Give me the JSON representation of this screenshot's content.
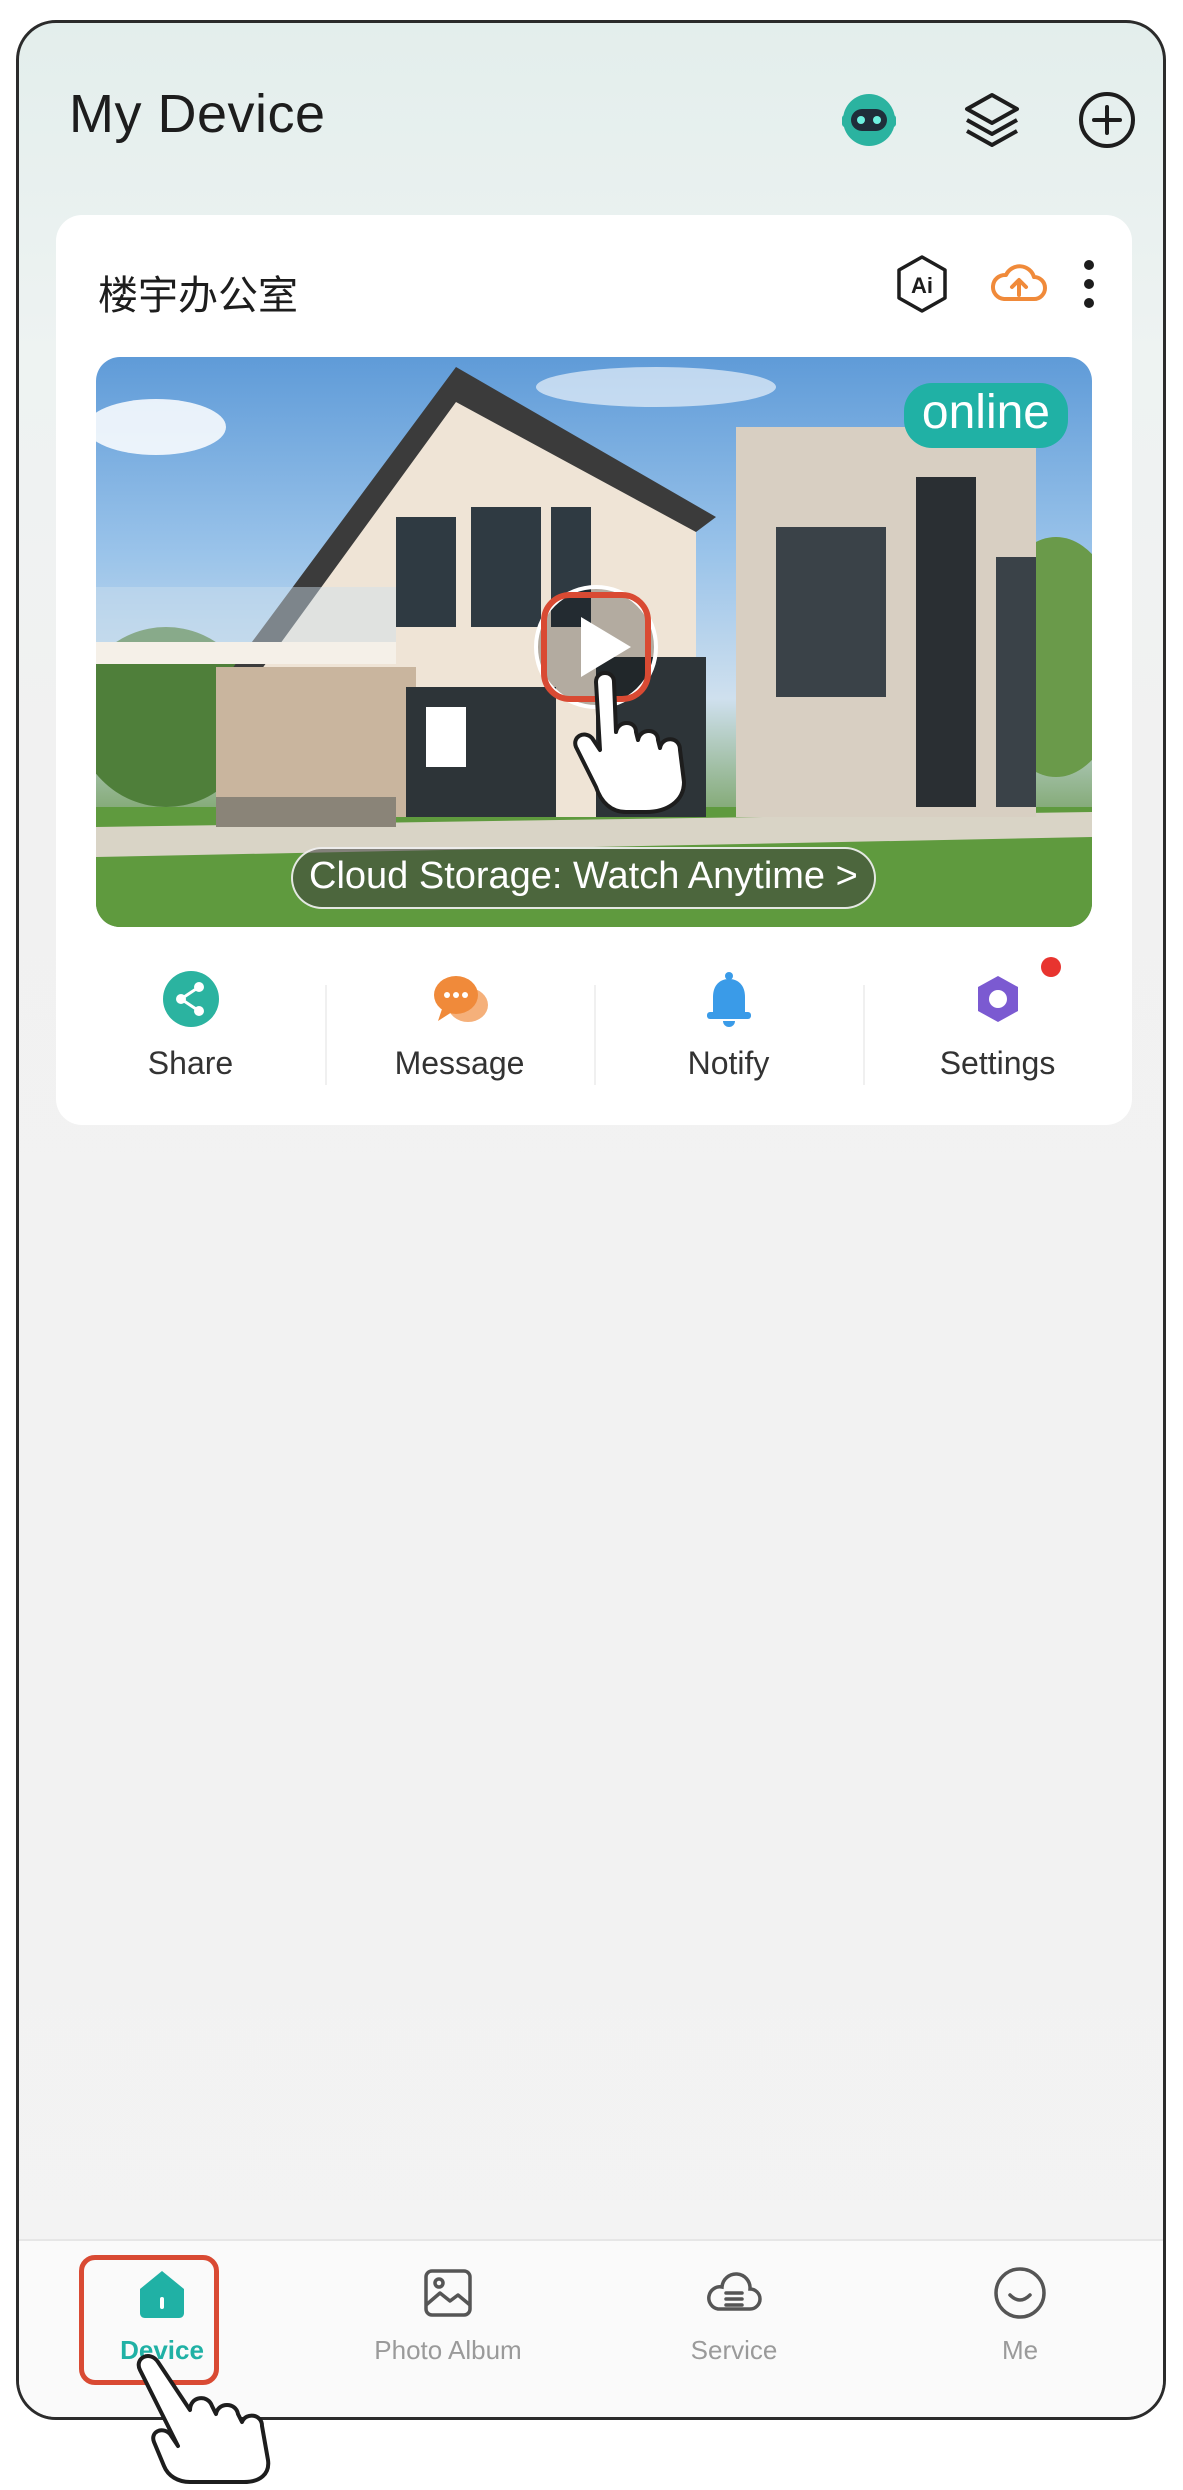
{
  "header": {
    "title": "My Device"
  },
  "device": {
    "name": "楼宇办公室",
    "status": "online",
    "cloud_banner": "Cloud Storage: Watch Anytime >",
    "actions": [
      {
        "label": "Share",
        "icon": "share-icon",
        "color": "#2bb3a0"
      },
      {
        "label": "Message",
        "icon": "message-icon",
        "color": "#f08a3a"
      },
      {
        "label": "Notify",
        "icon": "bell-icon",
        "color": "#3a9be8"
      },
      {
        "label": "Settings",
        "icon": "gear-icon",
        "color": "#7b5ad1"
      }
    ]
  },
  "bottom_nav": {
    "items": [
      {
        "label": "Device",
        "icon": "home-icon",
        "active": true
      },
      {
        "label": "Photo Album",
        "icon": "photo-icon",
        "active": false
      },
      {
        "label": "Service",
        "icon": "service-icon",
        "active": false
      },
      {
        "label": "Me",
        "icon": "smile-icon",
        "active": false
      }
    ]
  },
  "colors": {
    "accent": "#20b1a5",
    "highlight": "#d94a33",
    "cloud": "#f08a3a"
  }
}
